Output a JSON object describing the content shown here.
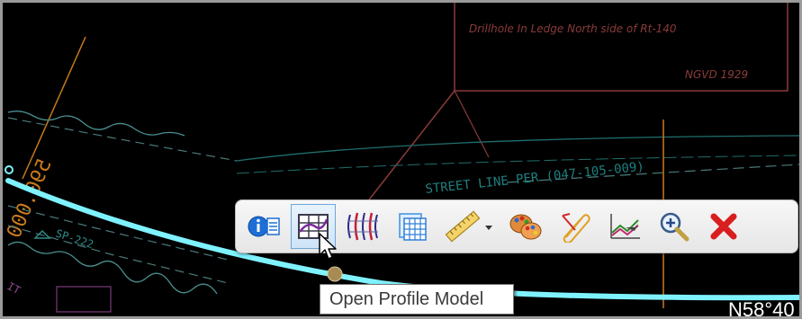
{
  "drawing": {
    "note_line1": "Drillhole In Ledge North side of Rt-140",
    "note_line2": "NGVD 1929",
    "contour_label": "590.000",
    "street_label": "STREET LINE PER (047-105-009)",
    "survey_point": "SP-222",
    "left_label_1": "IT",
    "bearing_fragment": "N58°40"
  },
  "toolbar": {
    "items": [
      {
        "name": "element-info-button",
        "icon": "info-list-icon"
      },
      {
        "name": "open-profile-model-button",
        "icon": "profile-grid-icon",
        "hovered": true
      },
      {
        "name": "open-cross-section-model-button",
        "icon": "cross-section-icon"
      },
      {
        "name": "table-view-button",
        "icon": "table-icon"
      },
      {
        "name": "measure-button",
        "icon": "ruler-icon",
        "has_dropdown": true
      },
      {
        "name": "properties-button",
        "icon": "palette-icon"
      },
      {
        "name": "attach-button",
        "icon": "paperclip-icon"
      },
      {
        "name": "profile-view-button",
        "icon": "profile-chart-icon"
      },
      {
        "name": "zoom-button",
        "icon": "zoom-icon"
      },
      {
        "name": "close-button",
        "icon": "close-icon"
      }
    ]
  },
  "tooltip": {
    "text": "Open Profile Model"
  },
  "colors": {
    "background": "#000000",
    "alignment": "#7ff2ff",
    "boundary": "#8a3a3a",
    "contour": "#c87a1e",
    "street": "#1f7f7f",
    "hover_fill": "#cfe4f8",
    "hover_border": "#6fa7d8"
  }
}
